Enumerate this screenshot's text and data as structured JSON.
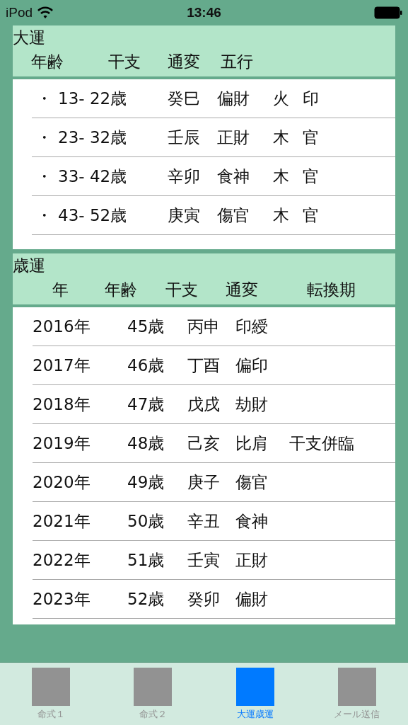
{
  "status_bar": {
    "device": "iPod",
    "time": "13:46"
  },
  "daiun": {
    "title": "大運",
    "columns": [
      "年齢",
      "干支",
      "通変",
      "五行"
    ],
    "rows": [
      {
        "bullet": "・",
        "age": "13- 22歳",
        "kanshi": "癸巳",
        "tsuhen": "偏財",
        "gogyo": "火",
        "column_5": "印"
      },
      {
        "bullet": "・",
        "age": "23- 32歳",
        "kanshi": "壬辰",
        "tsuhen": "正財",
        "gogyo": "木",
        "column_5": "官"
      },
      {
        "bullet": "・",
        "age": "33- 42歳",
        "kanshi": "辛卯",
        "tsuhen": "食神",
        "gogyo": "木",
        "column_5": "官"
      },
      {
        "bullet": "・",
        "age": "43- 52歳",
        "kanshi": "庚寅",
        "tsuhen": "傷官",
        "gogyo": "木",
        "column_5": "官"
      }
    ]
  },
  "saiun": {
    "title": "歳運",
    "columns": [
      "年",
      "年齢",
      "干支",
      "通変",
      "転換期"
    ],
    "rows": [
      {
        "year": "2016年",
        "age": "45歳",
        "kanshi": "丙申",
        "tsuhen": "印綬"
      },
      {
        "year": "2017年",
        "age": "46歳",
        "kanshi": "丁酉",
        "tsuhen": "偏印"
      },
      {
        "year": "2018年",
        "age": "47歳",
        "kanshi": "戊戌",
        "tsuhen": "劫財"
      },
      {
        "year": "2019年",
        "age": "48歳",
        "kanshi": "己亥",
        "tsuhen": "比肩",
        "turning": "干支併臨"
      },
      {
        "year": "2020年",
        "age": "49歳",
        "kanshi": "庚子",
        "tsuhen": "傷官"
      },
      {
        "year": "2021年",
        "age": "50歳",
        "kanshi": "辛丑",
        "tsuhen": "食神"
      },
      {
        "year": "2022年",
        "age": "51歳",
        "kanshi": "壬寅",
        "tsuhen": "正財"
      },
      {
        "year": "2023年",
        "age": "52歳",
        "kanshi": "癸卯",
        "tsuhen": "偏財"
      }
    ]
  },
  "tabs": [
    {
      "label": "命式１",
      "selected": false
    },
    {
      "label": "命式２",
      "selected": false
    },
    {
      "label": "大運歳運",
      "selected": true
    },
    {
      "label": "メール送信",
      "selected": false
    }
  ]
}
